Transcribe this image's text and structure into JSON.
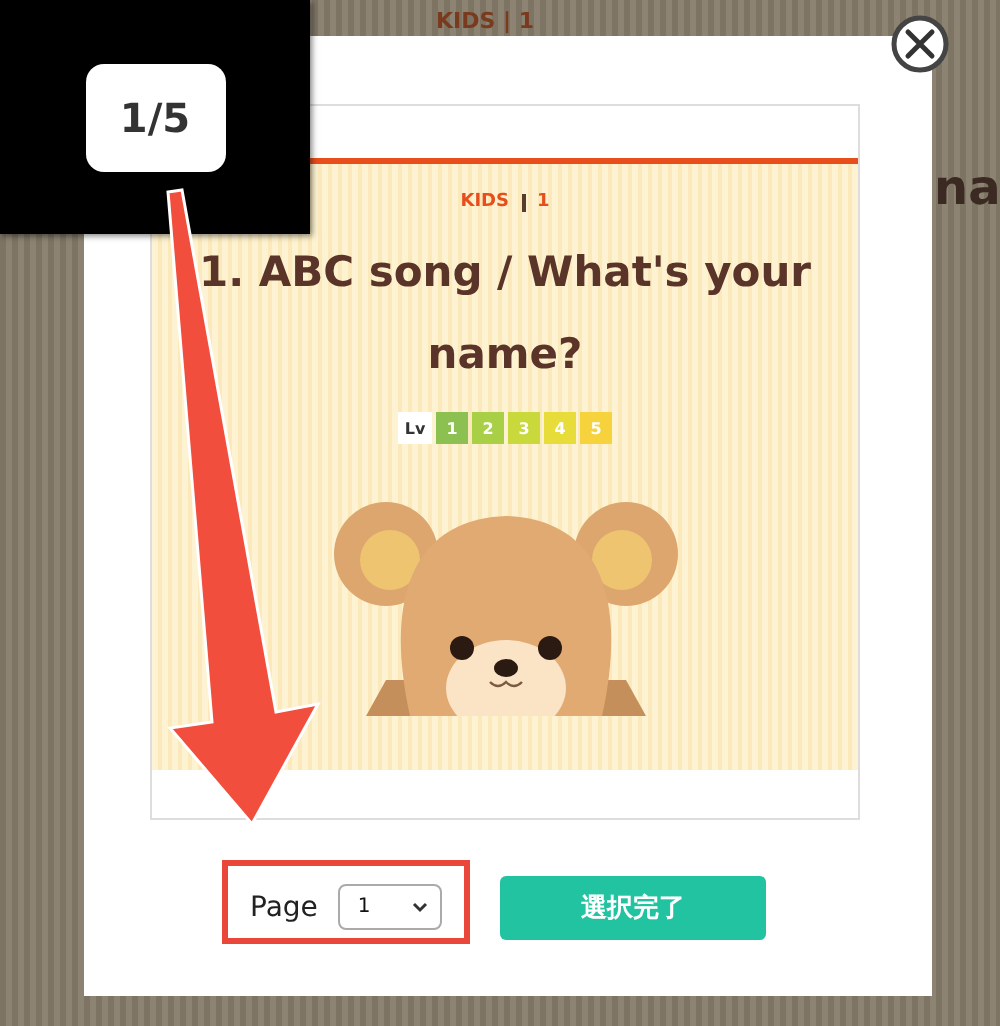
{
  "background": {
    "label": "KIDS | 1",
    "heading": "na"
  },
  "preview": {
    "category": "KIDS",
    "number": "1",
    "title": "1. ABC song / What's your name?",
    "level_label": "Lv",
    "levels": [
      {
        "label": "1",
        "color": "#8cc152"
      },
      {
        "label": "2",
        "color": "#a8cf45"
      },
      {
        "label": "3",
        "color": "#c9d93c"
      },
      {
        "label": "4",
        "color": "#e8dc3a"
      },
      {
        "label": "5",
        "color": "#f6d33c"
      }
    ]
  },
  "page_select": {
    "label": "Page",
    "value": "1"
  },
  "confirm_button": "選択完了",
  "annotation": {
    "label": "1/5"
  }
}
